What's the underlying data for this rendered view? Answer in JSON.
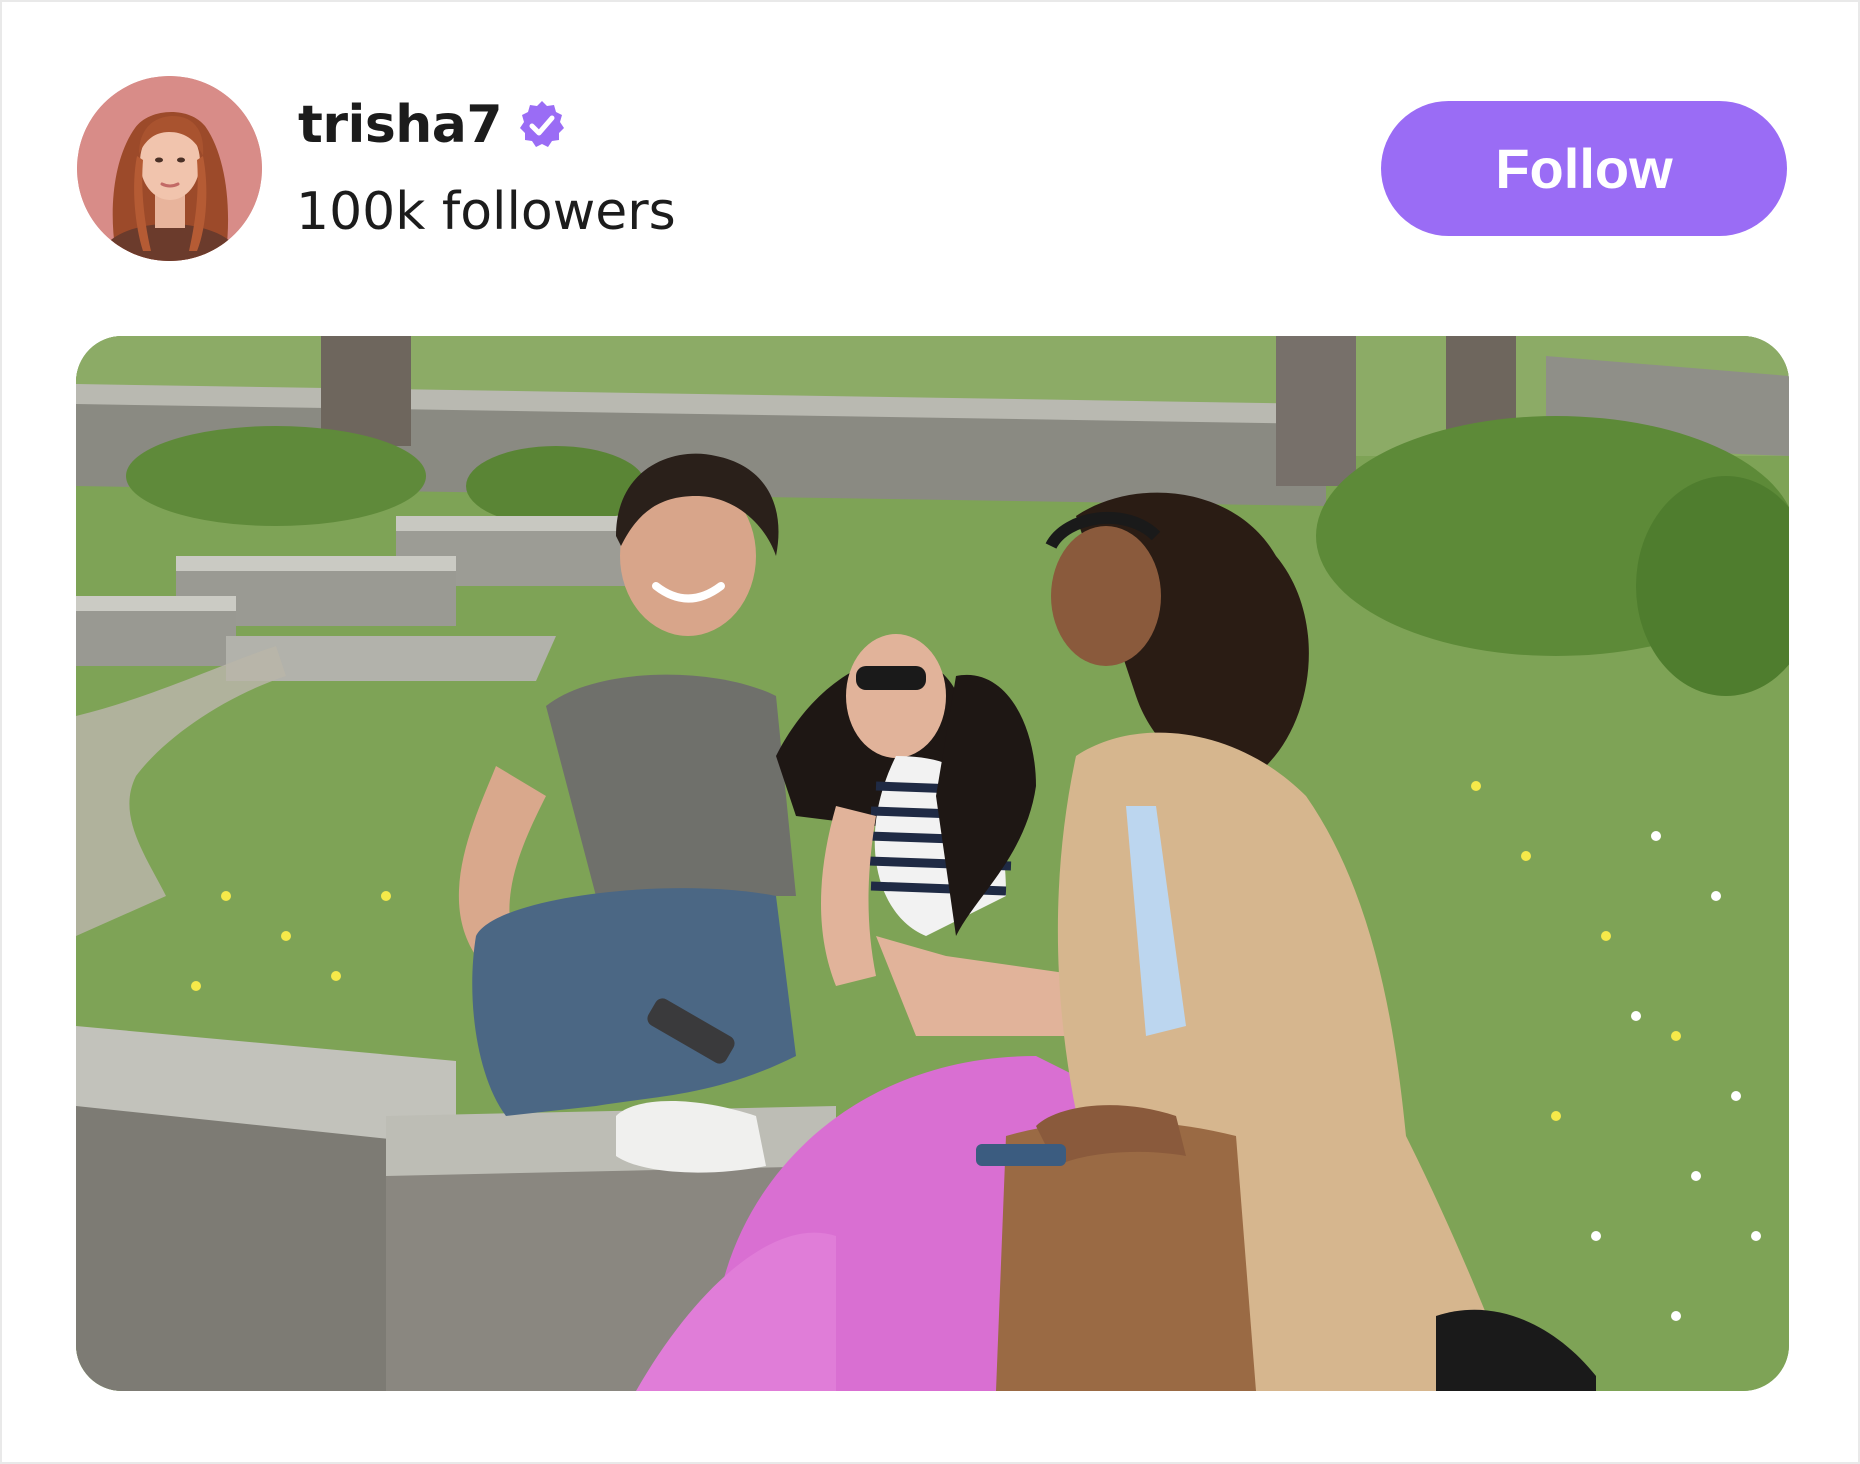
{
  "profile": {
    "username": "trisha7",
    "followers": "100k followers",
    "verified": true,
    "avatar_icon": "avatar-photo",
    "verified_icon": "verified-badge-icon"
  },
  "actions": {
    "follow_label": "Follow"
  },
  "colors": {
    "accent": "#9a6cf5",
    "text": "#1c1c1c",
    "avatar_bg": "#d98a86"
  },
  "post": {
    "image": "photo-friends-park"
  }
}
